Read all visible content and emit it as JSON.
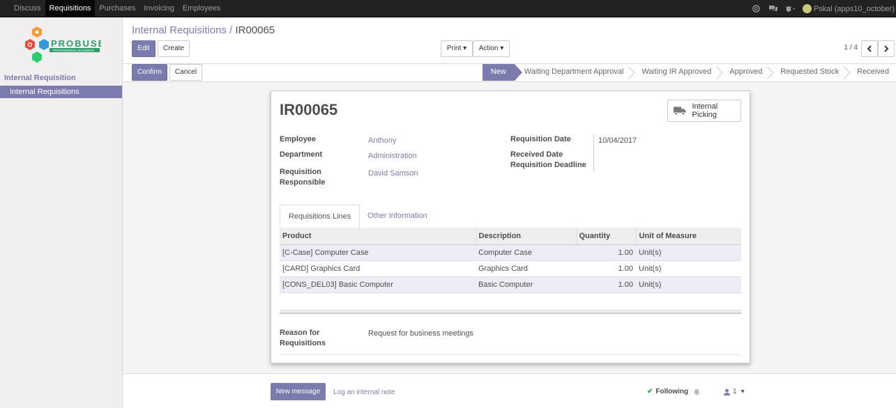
{
  "topbar": {
    "menu": [
      "Discuss",
      "Requisitions",
      "Purchases",
      "Invoicing",
      "Employees"
    ],
    "active_menu": "Requisitions",
    "user": "Pskal (apps10_october)"
  },
  "sidebar": {
    "logo_text": "PROBUSE",
    "logo_sub": "PROFESSIONAL BUSINESS",
    "section": "Internal Requisition",
    "item": "Internal Requisitions"
  },
  "breadcrumb": {
    "parent": "Internal Requisitions",
    "separator": "/",
    "current": "IR00065"
  },
  "buttons": {
    "edit": "Edit",
    "create": "Create",
    "print": "Print",
    "action": "Action",
    "confirm": "Confirm",
    "cancel": "Cancel"
  },
  "pager": {
    "text": "1 / 4"
  },
  "stages": [
    "New",
    "Waiting Department Approval",
    "Waiting IR Approved",
    "Approved",
    "Requested Stock",
    "Received"
  ],
  "active_stage": "New",
  "form": {
    "name": "IR00065",
    "smart_button": "Internal Picking",
    "employee_label": "Employee",
    "employee": "Anthony",
    "department_label": "Department",
    "department": "Administration",
    "responsible_label_1": "Requisition",
    "responsible_label_2": "Responsible",
    "responsible": "David Samson",
    "req_date_label": "Requisition Date",
    "req_date": "10/04/2017",
    "received_date_label": "Received Date",
    "deadline_label": "Requisition Deadline",
    "reason_label_1": "Reason for",
    "reason_label_2": "Requisitions",
    "reason": "Request for business meetings"
  },
  "tabs": [
    "Requisitions Lines",
    "Other Information"
  ],
  "lines": {
    "headers": [
      "Product",
      "Description",
      "Quantity",
      "Unit of Measure"
    ],
    "rows": [
      [
        "[C-Case] Computer Case",
        "Computer Case",
        "1.00",
        "Unit(s)"
      ],
      [
        "[CARD] Graphics Card",
        "Graphics Card",
        "1.00",
        "Unit(s)"
      ],
      [
        "[CONS_DEL03] Basic Computer",
        "Basic Computer",
        "1.00",
        "Unit(s)"
      ]
    ]
  },
  "chatter": {
    "new_message": "New message",
    "log_note": "Log an internal note",
    "following": "Following",
    "followers": "1"
  },
  "colors": {
    "accent": "#7c7bad",
    "topbar": "#222222"
  }
}
